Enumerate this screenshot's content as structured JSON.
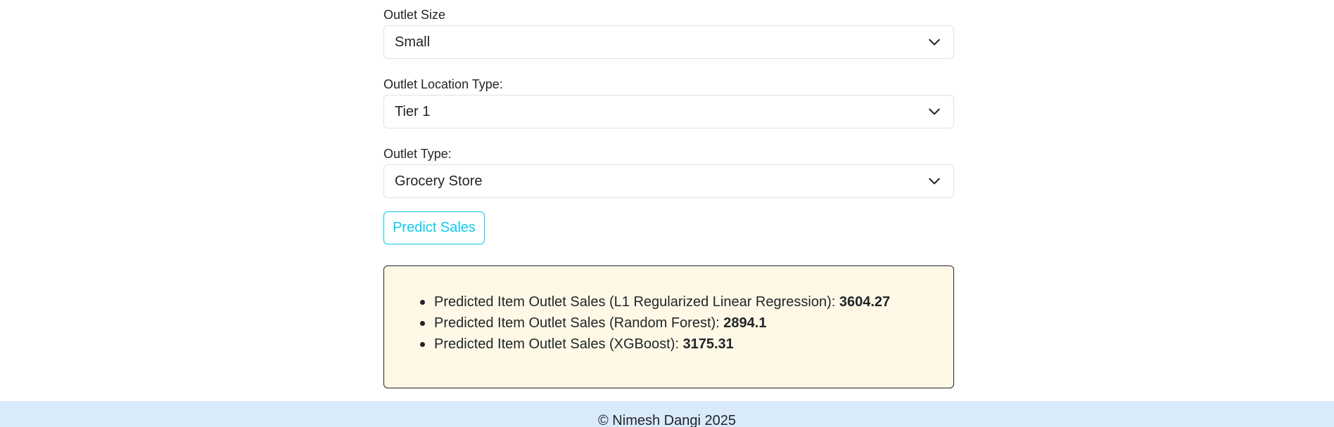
{
  "form": {
    "outlet_size": {
      "label": "Outlet Size",
      "value": "Small"
    },
    "outlet_location_type": {
      "label": "Outlet Location Type:",
      "value": "Tier 1"
    },
    "outlet_type": {
      "label": "Outlet Type:",
      "value": "Grocery Store"
    },
    "predict_button": "Predict Sales"
  },
  "results": [
    {
      "label": "Predicted Item Outlet Sales (L1 Regularized Linear Regression): ",
      "value": "3604.27"
    },
    {
      "label": "Predicted Item Outlet Sales (Random Forest): ",
      "value": "2894.1"
    },
    {
      "label": "Predicted Item Outlet Sales (XGBoost): ",
      "value": "3175.31"
    }
  ],
  "footer": {
    "text": "© Nimesh Dangi 2025"
  },
  "colors": {
    "accent": "#0dcaf0",
    "result_background": "#fff8e6",
    "footer_background": "#d9eafb"
  },
  "icons": {
    "dropdown": "chevron-down-icon"
  }
}
